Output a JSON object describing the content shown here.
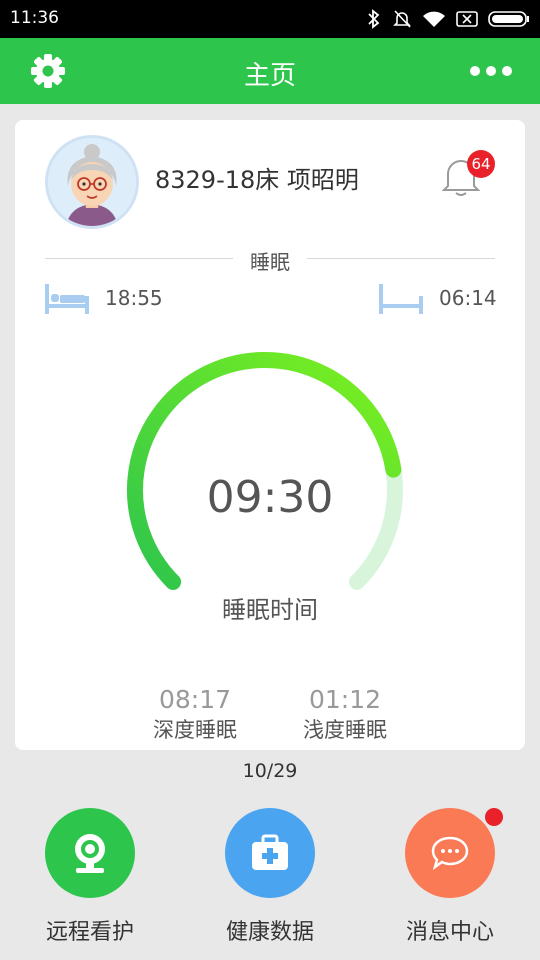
{
  "status_bar": {
    "time": "11:36"
  },
  "header": {
    "title": "主页"
  },
  "profile": {
    "name": "8329-18床 项昭明",
    "notification_count": "64"
  },
  "sleep": {
    "section_label": "睡眠",
    "bed_time": "18:55",
    "wake_time": "06:14",
    "total_time": "09:30",
    "total_label": "睡眠时间",
    "progress_fraction": 0.8,
    "deep_sleep": {
      "value": "08:17",
      "label": "深度睡眠"
    },
    "light_sleep": {
      "value": "01:12",
      "label": "浅度睡眠"
    }
  },
  "date": "10/29",
  "bottom_nav": [
    {
      "label": "远程看护",
      "icon": "camera-icon",
      "color": "#2ec54d"
    },
    {
      "label": "健康数据",
      "icon": "medical-kit-icon",
      "color": "#4aa4ef"
    },
    {
      "label": "消息中心",
      "icon": "chat-bubble-icon",
      "color": "#fb7a56",
      "has_dot": true
    }
  ],
  "colors": {
    "accent": "#2ec54d",
    "gauge_start": "#2ec54d",
    "gauge_end": "#7ef21e",
    "gauge_track": "#d8f5dc",
    "badge": "#e8212a"
  }
}
